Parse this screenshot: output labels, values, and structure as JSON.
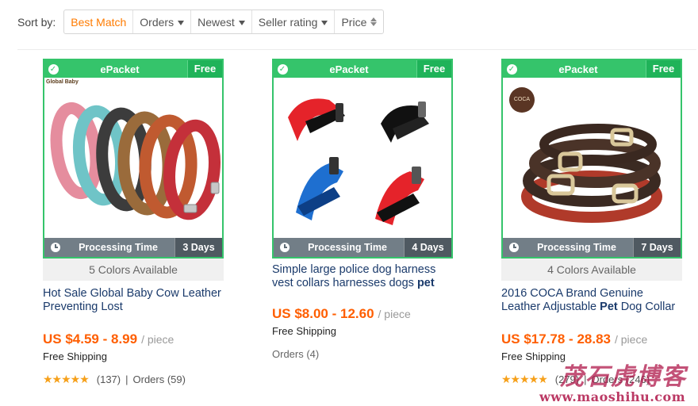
{
  "sort": {
    "label": "Sort by:",
    "options": [
      "Best Match",
      "Orders",
      "Newest",
      "Seller rating",
      "Price"
    ]
  },
  "badges": {
    "epacket": "ePacket",
    "free": "Free",
    "processing": "Processing Time"
  },
  "products": [
    {
      "brand_logo": "Global Baby",
      "days": "3 Days",
      "colors": "5 Colors Available",
      "title": "Hot Sale Global Baby Cow Leather Preventing Lost",
      "price": "US $4.59 - 8.99",
      "unit": "/ piece",
      "shipping": "Free Shipping",
      "rating_count": "(137)",
      "separator": "|",
      "orders": "Orders (59)"
    },
    {
      "days": "4 Days",
      "title_pre": "Simple large police dog harness vest collars harnesses dogs ",
      "title_bold": "pet",
      "price": "US $8.00 - 12.60",
      "unit": "/ piece",
      "shipping": "Free Shipping",
      "orders": "Orders (4)"
    },
    {
      "brand_logo": "COCA",
      "days": "7 Days",
      "colors": "4 Colors Available",
      "title_pre": "2016 COCA Brand Genuine Leather Adjustable ",
      "title_bold": "Pet",
      "title_post": " Dog Collar",
      "price": "US $17.78 - 28.83",
      "unit": "/ piece",
      "shipping": "Free Shipping",
      "rating_count": "(279)",
      "separator": "|",
      "orders": "Orders (246)"
    }
  ],
  "watermark": {
    "brand": "茂石虎博客",
    "url": "www.maoshihu.com"
  },
  "colors": {
    "accent": "#ff7b00",
    "green": "#35c46b",
    "price": "#ff5e00",
    "link": "#1a3a6b",
    "star": "#f6a01a"
  }
}
